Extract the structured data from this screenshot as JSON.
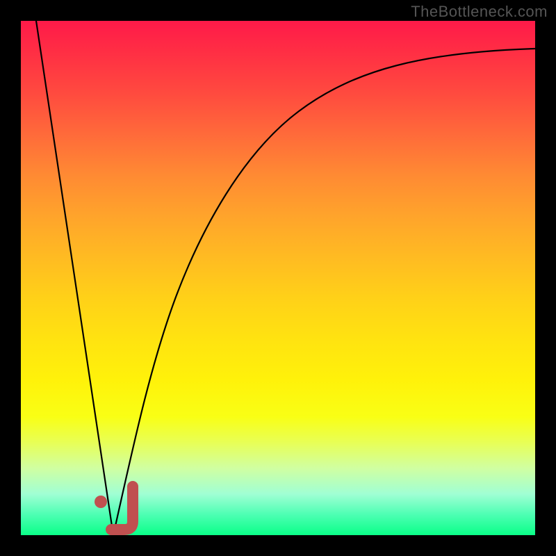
{
  "watermark": "TheBottleneck.com",
  "chart_data": {
    "type": "line",
    "title": "",
    "xlabel": "",
    "ylabel": "",
    "xlim": [
      0,
      100
    ],
    "ylim": [
      0,
      100
    ],
    "grid": false,
    "series": [
      {
        "name": "descending-line",
        "x": [
          3,
          18
        ],
        "y": [
          100,
          0
        ]
      },
      {
        "name": "ascending-curve",
        "x": [
          18,
          22,
          26,
          30,
          36,
          44,
          54,
          66,
          80,
          95,
          100
        ],
        "y": [
          0,
          18,
          34,
          46,
          58,
          70,
          80,
          87,
          91.5,
          94,
          94.7
        ]
      }
    ],
    "marker": {
      "name": "J-marker",
      "shape": "J",
      "x": 19,
      "y": 3,
      "dot": {
        "x": 15.5,
        "y": 7
      },
      "color": "#c05050"
    },
    "background_gradient": {
      "top": "#ff1a49",
      "middle": "#ffe310",
      "bottom": "#0aff88"
    }
  }
}
